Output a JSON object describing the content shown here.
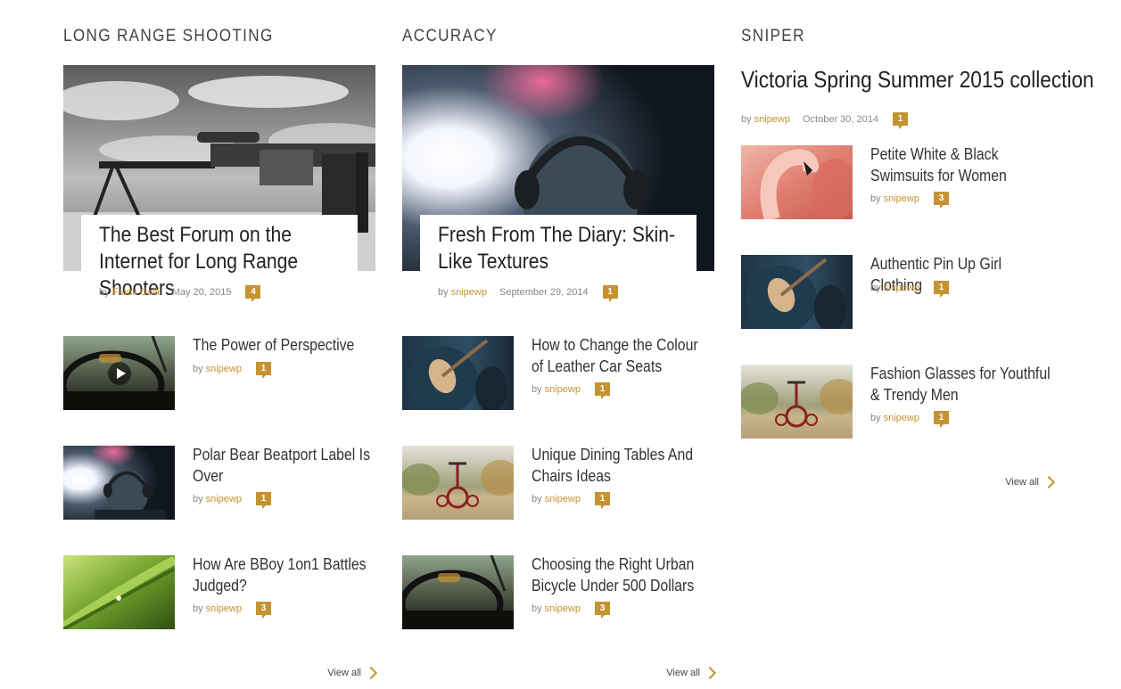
{
  "columns": [
    {
      "category": "LONG RANGE SHOOTING",
      "featured": {
        "title": "The Best Forum on the Internet for Long Range Shooters",
        "by": "by",
        "author": "Frank Galli",
        "date": "May 20, 2015",
        "comments": "4",
        "image": "sniper-rifle-bw"
      },
      "items": [
        {
          "title": "The Power of Perspective",
          "by": "by",
          "author": "snipewp",
          "comments": "1",
          "image": "steering-wheel",
          "has_play": true
        },
        {
          "title": "Polar Bear Beatport Label Is Over",
          "by": "by",
          "author": "snipewp",
          "comments": "1",
          "image": "headphones-light"
        },
        {
          "title": "How Are BBoy 1on1 Battles Judged?",
          "by": "by",
          "author": "snipewp",
          "comments": "3",
          "image": "green-leaf"
        }
      ],
      "view_all": "View all"
    },
    {
      "category": "ACCURACY",
      "featured": {
        "title": "Fresh From The Diary: Skin-Like Textures",
        "by": "by",
        "author": "snipewp",
        "date": "September 29, 2014",
        "comments": "1",
        "image": "headphones-light"
      },
      "items": [
        {
          "title": "How to Change the Colour of Leather Car Seats",
          "by": "by",
          "author": "snipewp",
          "comments": "1",
          "image": "guitar"
        },
        {
          "title": "Unique Dining Tables And Chairs Ideas",
          "by": "by",
          "author": "snipewp",
          "comments": "1",
          "image": "tricycle"
        },
        {
          "title": "Choosing the Right Urban Bicycle Under 500 Dollars",
          "by": "by",
          "author": "snipewp",
          "comments": "3",
          "image": "steering-wheel"
        }
      ],
      "view_all": "View all"
    },
    {
      "category": "SNIPER",
      "featured": {
        "title": "Victoria Spring Summer 2015 collection",
        "by": "by",
        "author": "snipewp",
        "date": "October 30, 2014",
        "comments": "1"
      },
      "items": [
        {
          "title": "Petite White & Black Swimsuits for Women",
          "by": "by",
          "author": "snipewp",
          "comments": "3",
          "image": "flamingo"
        },
        {
          "title": "Authentic Pin Up Girl Clothing",
          "by": "by",
          "author": "snipewp",
          "comments": "1",
          "image": "guitar"
        },
        {
          "title": "Fashion Glasses for Youthful & Trendy Men",
          "by": "by",
          "author": "snipewp",
          "comments": "1",
          "image": "tricycle"
        }
      ],
      "view_all": "View all"
    }
  ],
  "colors": {
    "accent": "#c69332",
    "heading": "#222222",
    "meta": "#888888",
    "background": "#ffffff"
  }
}
